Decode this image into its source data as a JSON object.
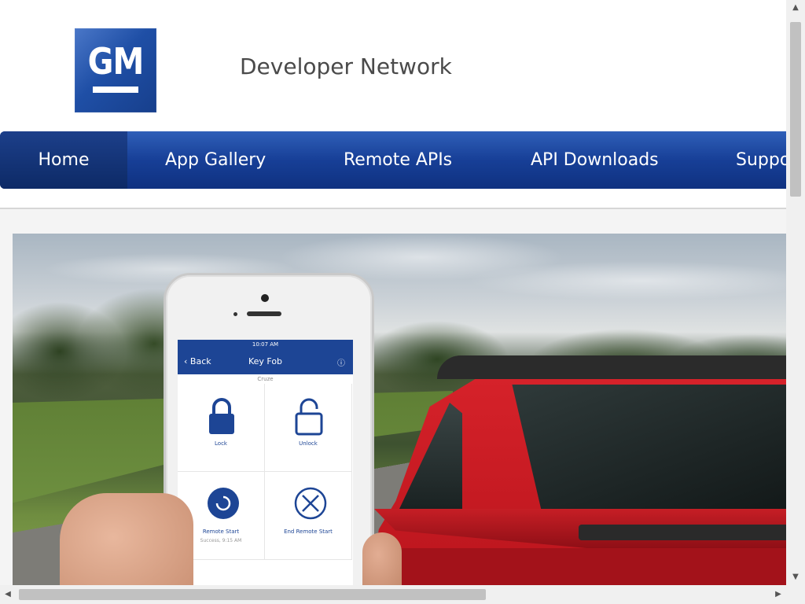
{
  "header": {
    "logo_text": "GM",
    "site_title": "Developer Network"
  },
  "nav": {
    "items": [
      {
        "label": "Home",
        "active": true
      },
      {
        "label": "App Gallery"
      },
      {
        "label": "Remote APIs"
      },
      {
        "label": "API Downloads"
      },
      {
        "label": "Support"
      }
    ]
  },
  "hero": {
    "phone": {
      "status_time": "10:07 AM",
      "back_label": "Back",
      "screen_title": "Key Fob",
      "vehicle": "Cruze",
      "tiles": [
        {
          "label": "Lock",
          "icon": "lock-icon"
        },
        {
          "label": "Unlock",
          "icon": "unlock-icon"
        },
        {
          "label": "Remote Start",
          "note": "Success, 9:15 AM",
          "icon": "remote-start-icon"
        },
        {
          "label": "End Remote Start",
          "icon": "end-remote-start-icon"
        }
      ]
    }
  },
  "colors": {
    "nav_blue": "#173f97",
    "nav_active": "#0d2a66",
    "app_blue": "#1d4595"
  }
}
